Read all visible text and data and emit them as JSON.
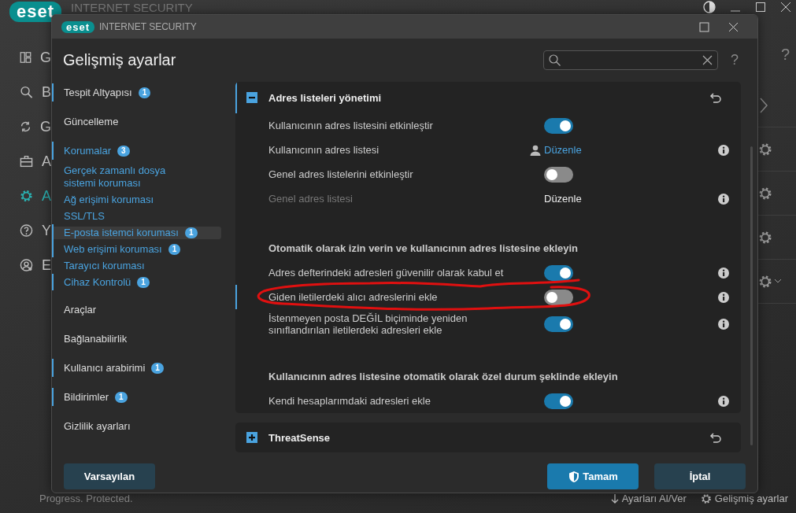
{
  "background_window": {
    "logo": "eset",
    "product": "INTERNET SECURITY",
    "help": "?",
    "nav": [
      {
        "label": "G",
        "selected": false
      },
      {
        "label": "B",
        "selected": false
      },
      {
        "label": "G",
        "selected": false
      },
      {
        "label": "A",
        "selected": false
      },
      {
        "label": "A",
        "selected": true
      },
      {
        "label": "Y",
        "selected": false
      },
      {
        "label": "E",
        "selected": false
      }
    ],
    "status": "Progress. Protected.",
    "footer_links": [
      "Ayarları Al/Ver",
      "Gelişmiş ayarlar"
    ]
  },
  "dialog": {
    "logo": "eset",
    "product": "INTERNET SECURITY",
    "title": "Gelişmiş ayarlar",
    "help": "?",
    "sidebar": {
      "items": [
        {
          "label": "Tespit Altyapısı",
          "badge": "1",
          "expanded": false,
          "selected": false
        },
        {
          "label": "Güncelleme",
          "expanded": false,
          "selected": false
        },
        {
          "label": "Korumalar",
          "badge": "3",
          "expanded": true,
          "selected": false,
          "children": [
            {
              "label": "Gerçek zamanlı dosya sistemi koruması",
              "selected": false
            },
            {
              "label": "Ağ erişimi koruması",
              "selected": false
            },
            {
              "label": "SSL/TLS",
              "selected": false
            },
            {
              "label": "E-posta istemci koruması",
              "badge": "1",
              "selected": true
            },
            {
              "label": "Web erişimi koruması",
              "badge": "1",
              "selected": false
            },
            {
              "label": "Tarayıcı koruması",
              "selected": false
            },
            {
              "label": "Cihaz Kontrolü",
              "badge": "1",
              "selected": false
            }
          ]
        },
        {
          "label": "Araçlar",
          "expanded": false,
          "selected": false
        },
        {
          "label": "Bağlanabilirlik",
          "expanded": false,
          "selected": false
        },
        {
          "label": "Kullanıcı arabirimi",
          "badge": "1",
          "expanded": false,
          "selected": false
        },
        {
          "label": "Bildirimler",
          "badge": "1",
          "expanded": false,
          "selected": false
        },
        {
          "label": "Gizlilik ayarları",
          "expanded": false,
          "selected": false
        }
      ]
    },
    "sections": [
      {
        "title": "Adres listeleri yönetimi",
        "expanded": true,
        "modified": true,
        "rows": [
          {
            "kind": "toggle",
            "label": "Kullanıcının adres listesini etkinleştir",
            "on": true,
            "info": false,
            "modified": false
          },
          {
            "kind": "link",
            "label": "Kullanıcının adres listesi",
            "action": "Düzenle",
            "disabled": false,
            "info": true,
            "modified": false
          },
          {
            "kind": "toggle",
            "label": "Genel adres listelerini etkinleştir",
            "on": false,
            "info": false,
            "modified": false
          },
          {
            "kind": "link",
            "label": "Genel adres listesi",
            "action": "Düzenle",
            "disabled": true,
            "info": true,
            "modified": false
          },
          {
            "kind": "heading",
            "label": "Otomatik olarak izin verin ve kullanıcının adres listesine ekleyin"
          },
          {
            "kind": "toggle",
            "label": "Adres defterindeki adresleri güvenilir olarak kabul et",
            "on": true,
            "info": true,
            "modified": false
          },
          {
            "kind": "toggle",
            "label": "Giden iletilerdeki alıcı adreslerini ekle",
            "on": false,
            "info": true,
            "modified": true
          },
          {
            "kind": "toggle",
            "label": "İstenmeyen posta DEĞİL biçiminde yeniden sınıflandırılan iletilerdeki adresleri ekle",
            "on": true,
            "info": true,
            "modified": false
          },
          {
            "kind": "heading",
            "label": "Kullanıcının adres listesine otomatik olarak özel durum şeklinde ekleyin"
          },
          {
            "kind": "toggle",
            "label": "Kendi hesaplarımdaki adresleri ekle",
            "on": true,
            "info": true,
            "modified": false
          }
        ]
      },
      {
        "title": "ThreatSense",
        "expanded": false,
        "modified": false
      }
    ],
    "buttons": [
      {
        "kind": "secondary",
        "label": "Varsayılan"
      },
      {
        "kind": "primary",
        "label": "Tamam"
      },
      {
        "kind": "secondary",
        "label": "İptal"
      }
    ]
  }
}
